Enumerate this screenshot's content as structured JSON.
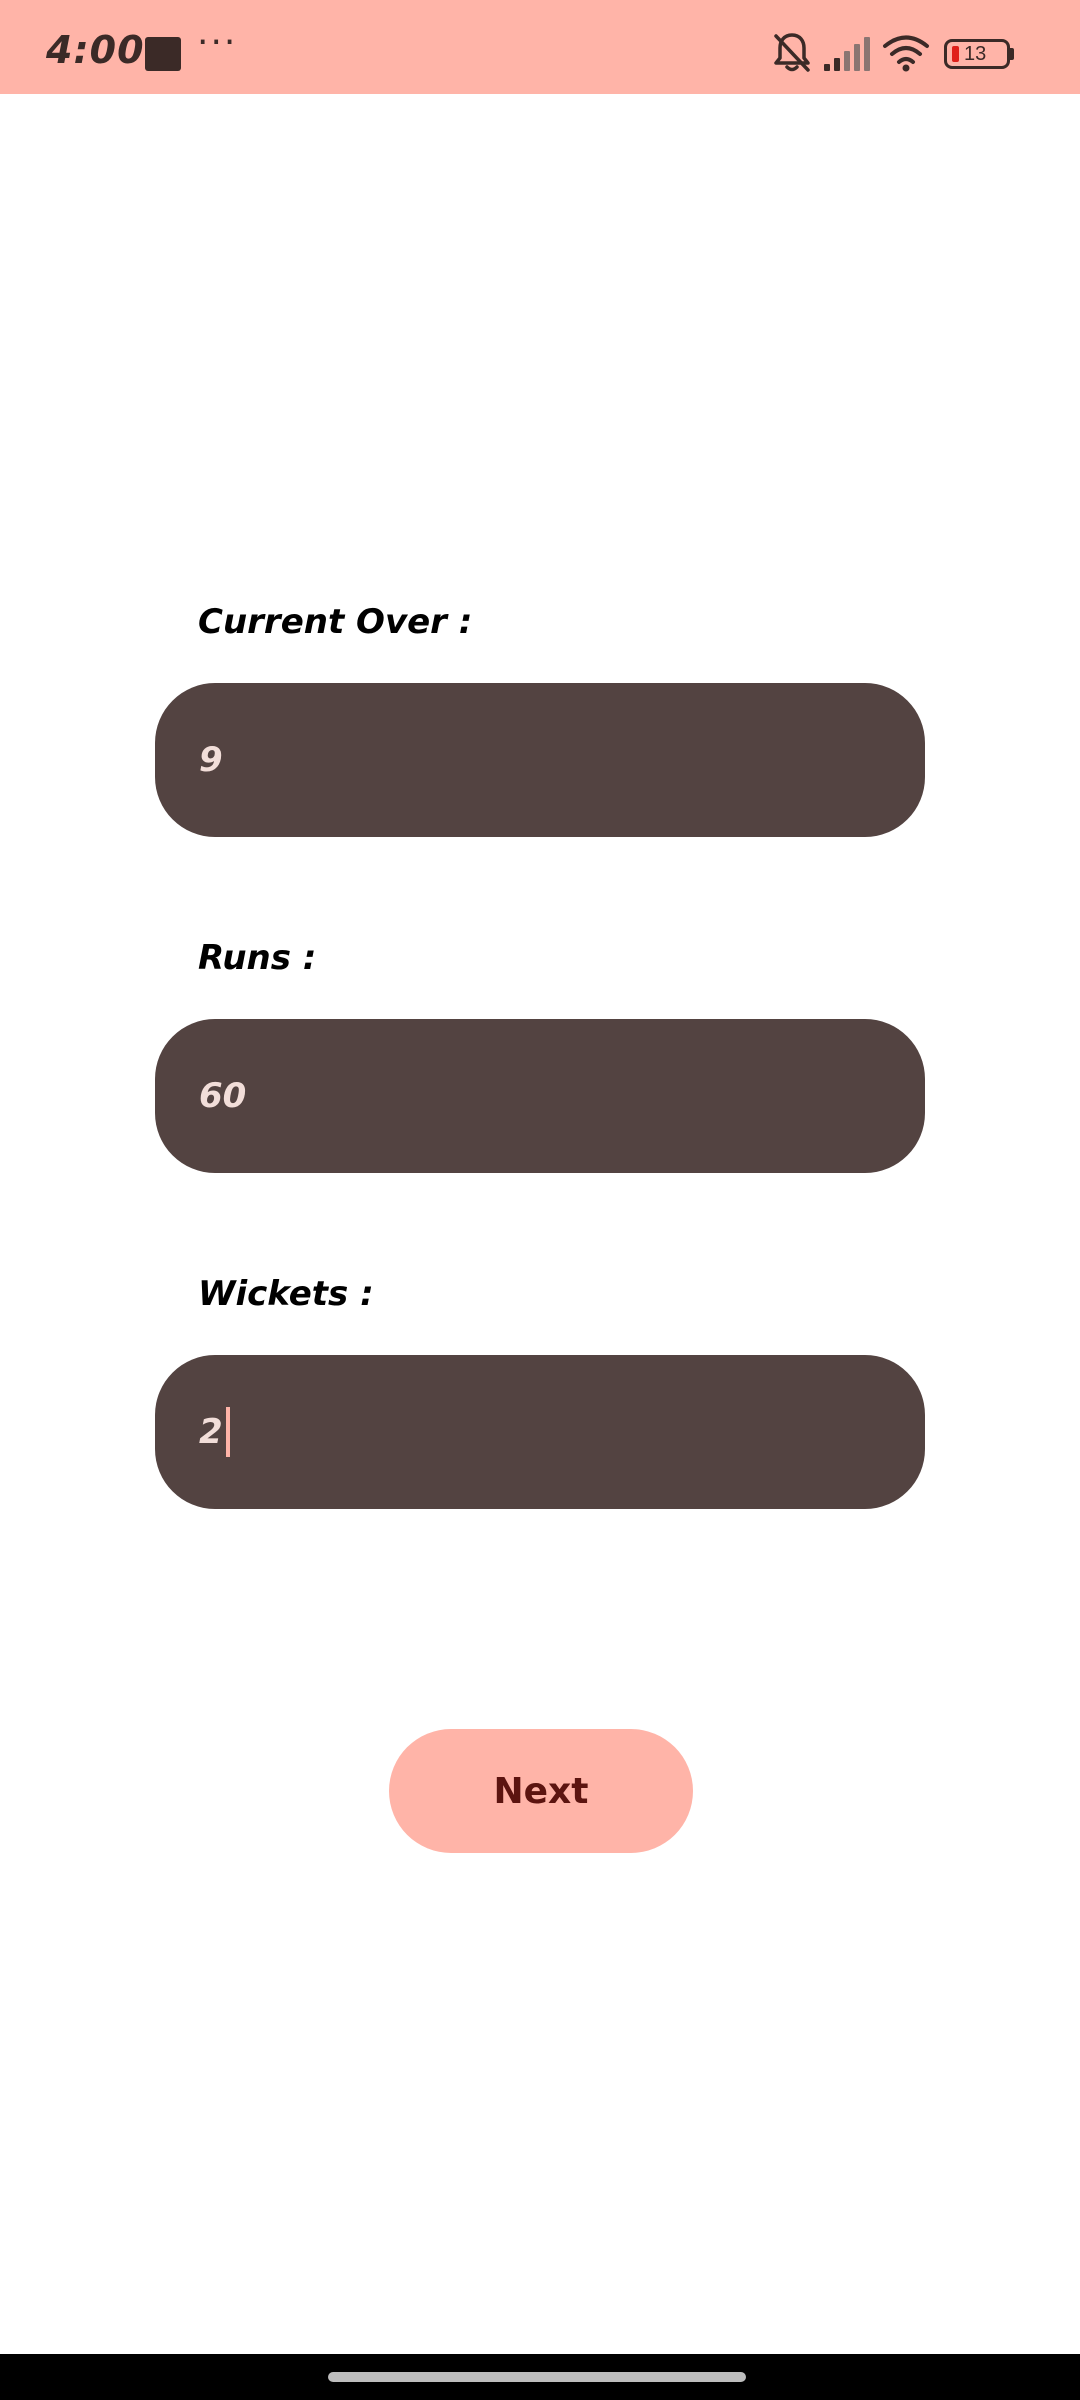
{
  "status_bar": {
    "time": "4:00",
    "dots": "···",
    "battery_level": "13",
    "icons": [
      "notification-square-icon",
      "bell-off-icon",
      "signal-icon",
      "wifi-icon",
      "battery-icon"
    ],
    "background_color": "#ffb4a8"
  },
  "form": {
    "current_over": {
      "label": "Current Over :",
      "value": "9"
    },
    "runs": {
      "label": "Runs :",
      "value": "60"
    },
    "wickets": {
      "label": "Wickets :",
      "value": "2"
    },
    "field_color": "#534341",
    "text_color": "#f2ded9"
  },
  "next_button": {
    "label": "Next",
    "color": "#ffb4a8"
  }
}
